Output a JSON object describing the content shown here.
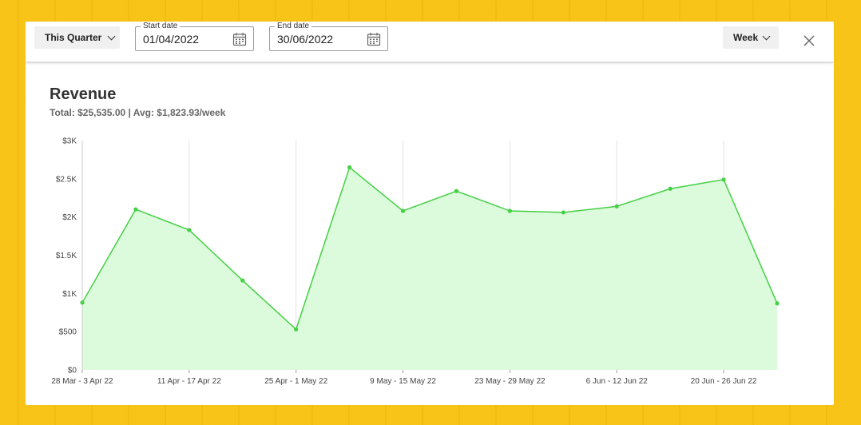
{
  "toolbar": {
    "period_label": "This Quarter",
    "start_date_label": "Start date",
    "start_date_value": "01/04/2022",
    "end_date_label": "End date",
    "end_date_value": "30/06/2022",
    "granularity_label": "Week"
  },
  "colors": {
    "line": "#45d045",
    "fill": "#dcfadc",
    "grid": "#e2e2e2",
    "background": "#f6be12"
  },
  "chart_data": {
    "type": "area",
    "title": "Revenue",
    "subtitle": "Total: $25,535.00 | Avg: $1,823.93/week",
    "ylim": [
      0,
      3000
    ],
    "y_ticks": [
      {
        "value": 0,
        "label": "$0"
      },
      {
        "value": 500,
        "label": "$500"
      },
      {
        "value": 1000,
        "label": "$1K"
      },
      {
        "value": 1500,
        "label": "$1.5K"
      },
      {
        "value": 2000,
        "label": "$2K"
      },
      {
        "value": 2500,
        "label": "$2.5K"
      },
      {
        "value": 3000,
        "label": "$3K"
      }
    ],
    "x_labels": [
      {
        "index": 0,
        "label": "28 Mar - 3 Apr 22"
      },
      {
        "index": 2,
        "label": "11 Apr - 17 Apr 22"
      },
      {
        "index": 4,
        "label": "25 Apr - 1 May 22"
      },
      {
        "index": 6,
        "label": "9 May - 15 May 22"
      },
      {
        "index": 8,
        "label": "23 May - 29 May 22"
      },
      {
        "index": 10,
        "label": "6 Jun - 12 Jun 22"
      },
      {
        "index": 12,
        "label": "20 Jun - 26 Jun 22"
      }
    ],
    "grid_x": true,
    "values": [
      880,
      2100,
      1830,
      1170,
      530,
      2650,
      2080,
      2340,
      2080,
      2060,
      2140,
      2370,
      2490,
      870
    ]
  }
}
